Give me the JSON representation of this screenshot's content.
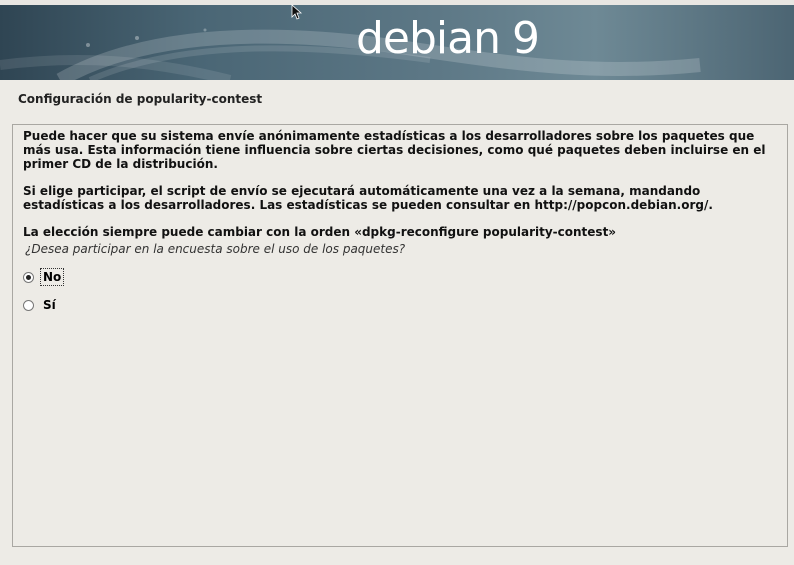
{
  "banner": {
    "logo_word": "debian",
    "logo_version": "9",
    "bg_color": "#4a6675",
    "logo_color": "#ffffff"
  },
  "step": {
    "title": "Configuración de popularity-contest"
  },
  "description": {
    "paragraphs": [
      "Puede hacer que su sistema envíe anónimamente estadísticas a los desarrolladores sobre los paquetes que más usa. Esta información tiene influencia sobre ciertas decisiones, como qué paquetes deben incluirse en el primer CD de la distribución.",
      "Si elige participar, el script de envío se ejecutará automáticamente una vez a la semana, mandando estadísticas a los desarrolladores. Las estadísticas se pueden consultar en http://popcon.debian.org/.",
      "La elección siempre puede cambiar con la orden «dpkg-reconfigure popularity-contest»"
    ]
  },
  "question": {
    "text": "¿Desea participar en la encuesta sobre el uso de los paquetes?",
    "options": [
      {
        "label": "No",
        "selected": true
      },
      {
        "label": "Sí",
        "selected": false
      }
    ]
  },
  "icons": {
    "cursor": "mouse-pointer-icon",
    "radio_on": "radio-checked-icon",
    "radio_off": "radio-unchecked-icon"
  }
}
